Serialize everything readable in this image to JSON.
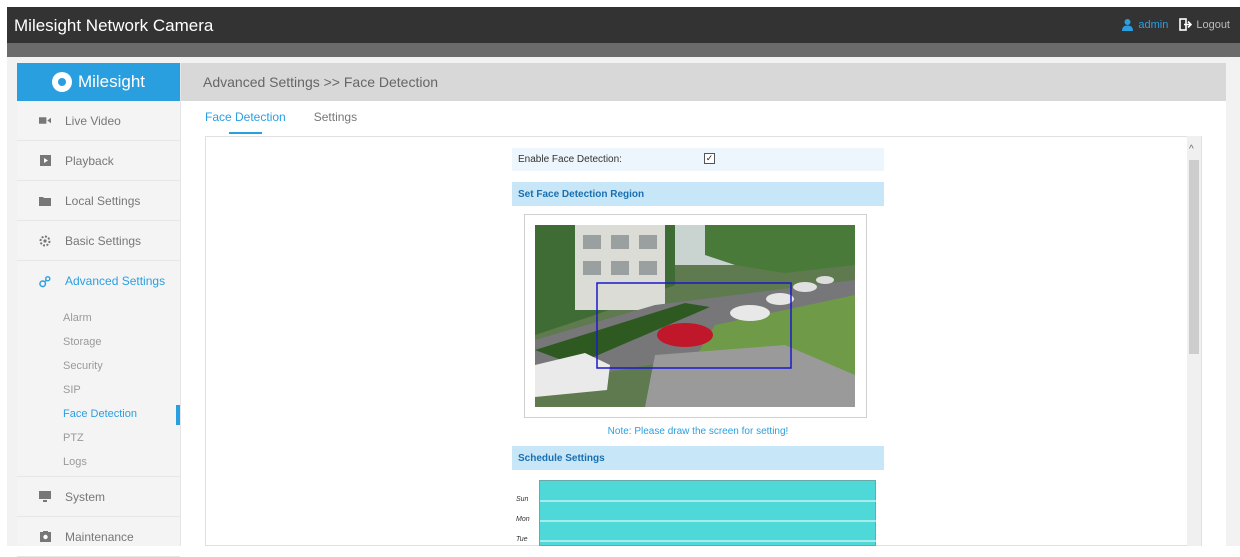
{
  "app": {
    "title": "Milesight Network Camera"
  },
  "user": {
    "name": "admin",
    "logout_label": "Logout"
  },
  "brand": {
    "name": "Milesight"
  },
  "sidebar": {
    "items": [
      {
        "label": "Live Video",
        "icon": "video-camera-icon"
      },
      {
        "label": "Playback",
        "icon": "playback-icon"
      },
      {
        "label": "Local Settings",
        "icon": "folder-icon"
      },
      {
        "label": "Basic Settings",
        "icon": "gear-icon"
      },
      {
        "label": "Advanced Settings",
        "icon": "advanced-settings-icon"
      }
    ],
    "sub_items": [
      "Alarm",
      "Storage",
      "Security",
      "SIP",
      "Face Detection",
      "PTZ",
      "Logs"
    ],
    "bottom_items": [
      {
        "label": "System",
        "icon": "monitor-icon"
      },
      {
        "label": "Maintenance",
        "icon": "maintenance-icon"
      }
    ]
  },
  "breadcrumb": "Advanced Settings >> Face Detection",
  "tabs": [
    {
      "label": "Face Detection"
    },
    {
      "label": "Settings"
    }
  ],
  "form": {
    "enable_label": "Enable Face Detection:",
    "enable_checked": true,
    "region_title": "Set Face Detection Region",
    "note": "Note: Please draw the screen for setting!",
    "schedule_title": "Schedule Settings",
    "schedule_days": [
      "Sun",
      "Mon",
      "Tue"
    ]
  },
  "colors": {
    "accent": "#2a9fe0",
    "topbar": "#333333",
    "region_box": "#1a1acc",
    "schedule_fill": "#4fd8d8"
  }
}
